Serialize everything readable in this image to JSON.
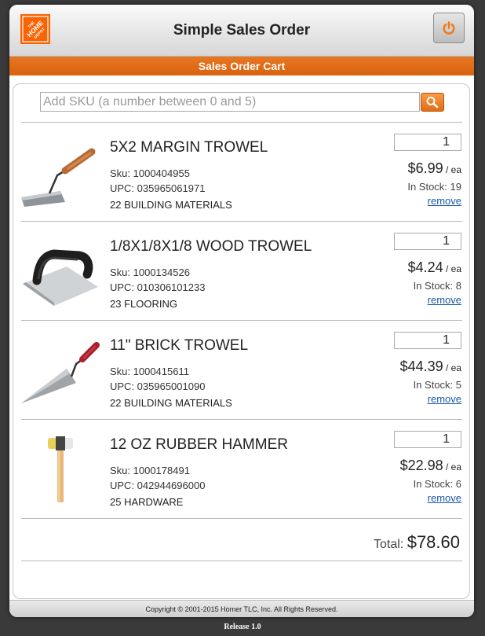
{
  "header": {
    "title": "Simple Sales Order",
    "logo_text": [
      "THE",
      "HOME",
      "DEPOT"
    ],
    "power_icon": "power-icon"
  },
  "subbar": {
    "title": "Sales Order Cart"
  },
  "search": {
    "placeholder": "Add SKU (a number between 0 and 5)",
    "value": "",
    "button_icon": "search-icon"
  },
  "items": [
    {
      "name": "5X2 MARGIN TROWEL",
      "sku": "Sku: 1000404955",
      "upc": "UPC: 035965061971",
      "department": "22 BUILDING MATERIALS",
      "quantity": "1",
      "price": "$6.99",
      "unit": " / ea",
      "stock": "In Stock: 19",
      "remove_label": "remove",
      "icon": "margin-trowel-icon"
    },
    {
      "name": "1/8X1/8X1/8 WOOD TROWEL",
      "sku": "Sku: 1000134526",
      "upc": "UPC: 010306101233",
      "department": "23 FLOORING",
      "quantity": "1",
      "price": "$4.24",
      "unit": " / ea",
      "stock": "In Stock: 8",
      "remove_label": "remove",
      "icon": "notched-trowel-icon"
    },
    {
      "name": "11\" BRICK TROWEL",
      "sku": "Sku: 1000415611",
      "upc": "UPC: 035965001090",
      "department": "22 BUILDING MATERIALS",
      "quantity": "1",
      "price": "$44.39",
      "unit": " / ea",
      "stock": "In Stock: 5",
      "remove_label": "remove",
      "icon": "brick-trowel-icon"
    },
    {
      "name": "12 OZ RUBBER HAMMER",
      "sku": "Sku: 1000178491",
      "upc": "UPC: 042944696000",
      "department": "25 HARDWARE",
      "quantity": "1",
      "price": "$22.98",
      "unit": " / ea",
      "stock": "In Stock: 6",
      "remove_label": "remove",
      "icon": "rubber-hammer-icon"
    }
  ],
  "total": {
    "label": "Total:",
    "value": "$78.60"
  },
  "footer": {
    "copyright": "Copyright © 2001-2015 Homer TLC, Inc. All Rights Reserved."
  },
  "release": "Release 1.0",
  "colors": {
    "brand_orange": "#f96302",
    "subbar_orange": "#e06a13",
    "link_blue": "#1a5aa8"
  }
}
